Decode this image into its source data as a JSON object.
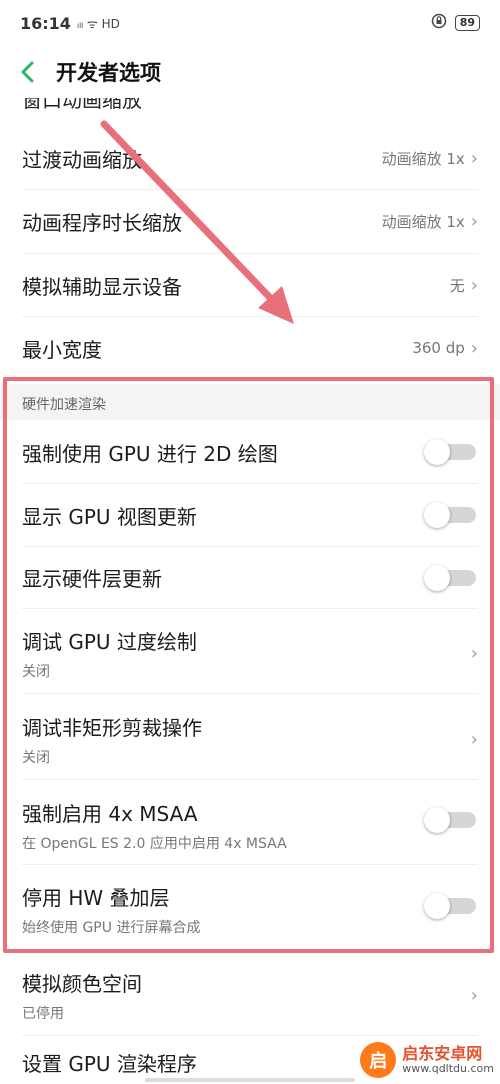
{
  "status_bar": {
    "time": "16:14",
    "signal_icons": "ᵢₗₗ ᯤ HD",
    "battery": "89"
  },
  "header": {
    "title": "开发者选项"
  },
  "clipped_item": {
    "label": "窗口动画缩放"
  },
  "items_top": [
    {
      "label": "过渡动画缩放",
      "value": "动画缩放 1x"
    },
    {
      "label": "动画程序时长缩放",
      "value": "动画缩放 1x"
    },
    {
      "label": "模拟辅助显示设备",
      "value": "无"
    },
    {
      "label": "最小宽度",
      "value": "360 dp"
    }
  ],
  "section": {
    "title": "硬件加速渲染"
  },
  "toggle_items": [
    {
      "label": "强制使用 GPU 进行 2D 绘图",
      "enabled": false
    },
    {
      "label": "显示 GPU 视图更新",
      "enabled": false
    },
    {
      "label": "显示硬件层更新",
      "enabled": false
    }
  ],
  "nav_items": [
    {
      "label": "调试 GPU 过度绘制",
      "sub": "关闭"
    },
    {
      "label": "调试非矩形剪裁操作",
      "sub": "关闭"
    }
  ],
  "toggle_sub_items": [
    {
      "label": "强制启用 4x MSAA",
      "sub": "在 OpenGL ES 2.0 应用中启用 4x MSAA",
      "enabled": false
    },
    {
      "label": "停用 HW 叠加层",
      "sub": "始终使用 GPU 进行屏幕合成",
      "enabled": false
    }
  ],
  "items_bottom": [
    {
      "label": "模拟颜色空间",
      "sub": "已停用"
    },
    {
      "label": "设置 GPU 渲染程序"
    }
  ],
  "chevron": "›",
  "watermark": {
    "title": "启东安卓网",
    "url": "www.qdltdu.com",
    "logo_char": "启"
  },
  "colors": {
    "accent": "#2fb36a",
    "highlight": "#e8707a",
    "watermark": "#ff7a1a"
  }
}
